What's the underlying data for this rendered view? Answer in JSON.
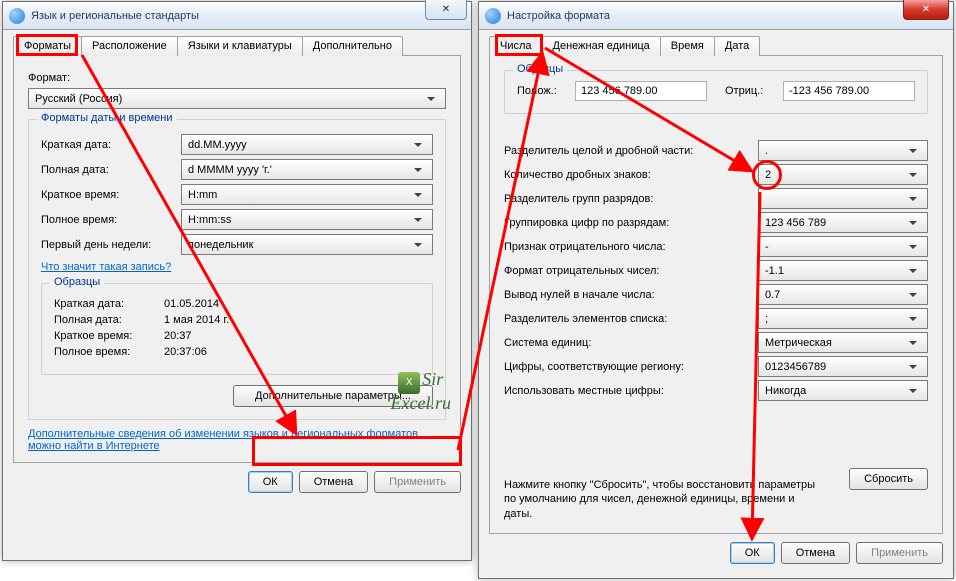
{
  "dlg1": {
    "title": "Язык и региональные стандарты",
    "tabs": [
      "Форматы",
      "Расположение",
      "Языки и клавиатуры",
      "Дополнительно"
    ],
    "format_label": "Формат:",
    "format_value": "Русский (Россия)",
    "date_formats_legend": "Форматы даты и времени",
    "fields": [
      {
        "label": "Краткая дата:",
        "value": "dd.MM.yyyy"
      },
      {
        "label": "Полная дата:",
        "value": "d MMMM yyyy 'г.'"
      },
      {
        "label": "Краткое время:",
        "value": "H:mm"
      },
      {
        "label": "Полное время:",
        "value": "H:mm:ss"
      },
      {
        "label": "Первый день недели:",
        "value": "понедельник"
      }
    ],
    "what_link": "Что значит такая запись?",
    "samples_legend": "Образцы",
    "samples": [
      {
        "label": "Краткая дата:",
        "value": "01.05.2014"
      },
      {
        "label": "Полная дата:",
        "value": "1 мая 2014 г."
      },
      {
        "label": "Краткое время:",
        "value": "20:37"
      },
      {
        "label": "Полное время:",
        "value": "20:37:06"
      }
    ],
    "adv_btn": "Дополнительные параметры...",
    "more_link": "Дополнительные сведения об изменении языков и региональных форматов можно найти в Интернете",
    "ok": "ОК",
    "cancel": "Отмена",
    "apply": "Применить"
  },
  "dlg2": {
    "title": "Настройка формата",
    "tabs": [
      "Числа",
      "Денежная единица",
      "Время",
      "Дата"
    ],
    "samples_legend": "Образцы",
    "pos_label": "Полож.:",
    "pos_value": "123 456 789.00",
    "neg_label": "Отриц.:",
    "neg_value": "-123 456 789.00",
    "fields": [
      {
        "label": "Разделитель целой и дробной части:",
        "value": "."
      },
      {
        "label": "Количество дробных знаков:",
        "value": "2"
      },
      {
        "label": "Разделитель групп разрядов:",
        "value": ""
      },
      {
        "label": "Группировка цифр по разрядам:",
        "value": "123 456 789"
      },
      {
        "label": "Признак отрицательного числа:",
        "value": "-"
      },
      {
        "label": "Формат отрицательных чисел:",
        "value": "-1.1"
      },
      {
        "label": "Вывод нулей в начале числа:",
        "value": "0.7"
      },
      {
        "label": "Разделитель элементов списка:",
        "value": ";"
      },
      {
        "label": "Система единиц:",
        "value": "Метрическая"
      },
      {
        "label": "Цифры, соответствующие региону:",
        "value": "0123456789"
      },
      {
        "label": "Использовать местные цифры:",
        "value": "Никогда"
      }
    ],
    "hint": "Нажмите кнопку \"Сбросить\", чтобы восстановить параметры по умолчанию для чисел, денежной единицы, времени и даты.",
    "reset": "Сбросить",
    "ok": "ОК",
    "cancel": "Отмена",
    "apply": "Применить"
  },
  "logo": {
    "brand": "Sir",
    "site": "Excel.ru"
  }
}
